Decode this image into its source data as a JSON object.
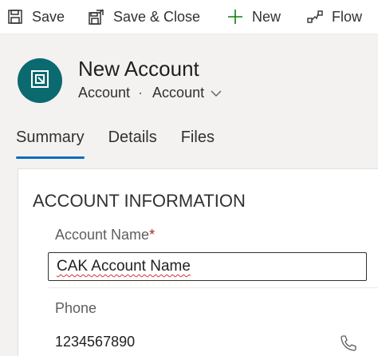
{
  "toolbar": {
    "save_label": "Save",
    "save_close_label": "Save & Close",
    "new_label": "New",
    "flow_label": "Flow"
  },
  "header": {
    "title": "New Account",
    "entity_label": "Account",
    "separator": "·",
    "form_selector_label": "Account"
  },
  "tabs": [
    {
      "label": "Summary",
      "active": true
    },
    {
      "label": "Details",
      "active": false
    },
    {
      "label": "Files",
      "active": false
    }
  ],
  "section": {
    "title": "ACCOUNT INFORMATION",
    "fields": {
      "account_name": {
        "label": "Account Name",
        "required_marker": "*",
        "value": "CAK Account Name"
      },
      "phone": {
        "label": "Phone",
        "value": "1234567890"
      }
    }
  },
  "icons": {
    "save": "save-icon",
    "save_close": "save-close-icon",
    "new": "plus-icon",
    "flow": "flow-icon",
    "entity": "account-entity-icon",
    "chevron": "chevron-down-icon",
    "phone": "phone-icon"
  },
  "colors": {
    "accent": "#0f6cbd",
    "avatar_bg": "#0b6a6f",
    "required": "#a4262c",
    "new_icon": "#107c10",
    "spellcheck": "#d13438"
  }
}
